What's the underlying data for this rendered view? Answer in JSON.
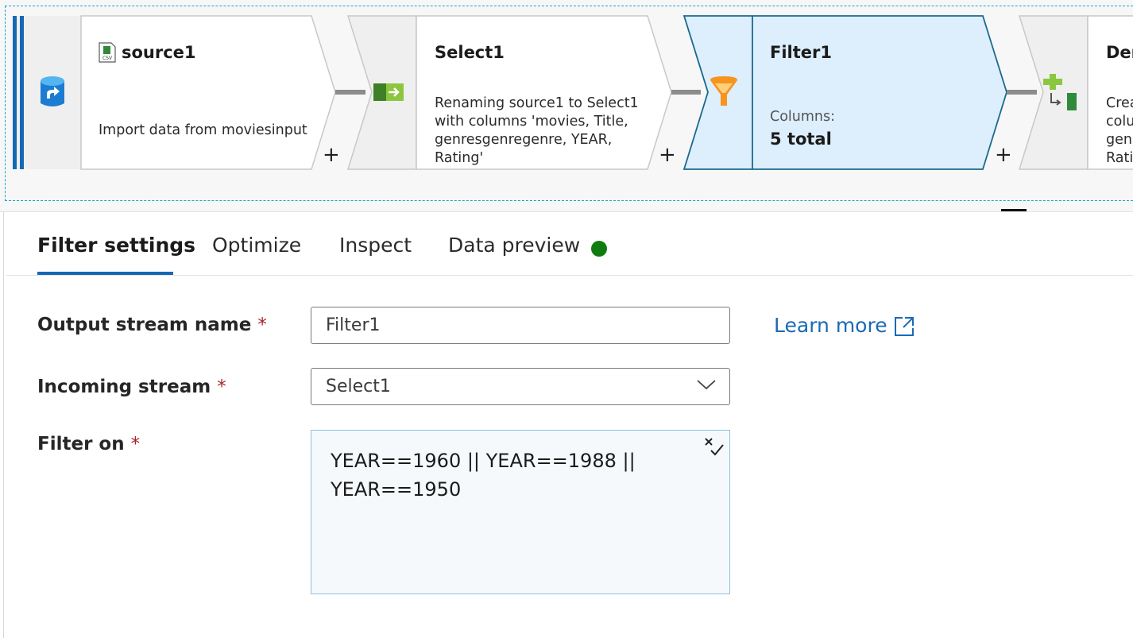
{
  "pipeline": {
    "nodes": [
      {
        "title": "source1",
        "description": "Import data from moviesinput",
        "icon": "database-source-icon",
        "badge_icon": "csv-file-icon"
      },
      {
        "title": "Select1",
        "description_lines": [
          "Renaming source1 to Select1",
          "with columns 'movies, Title,",
          "genresgenregenre, YEAR,",
          "Rating'"
        ],
        "icon": "select-transform-icon"
      },
      {
        "title": "Filter1",
        "columns_label": "Columns:",
        "columns_value": "5 total",
        "icon": "funnel-filter-icon",
        "selected": true
      },
      {
        "title": "Der",
        "description_lines": [
          "Crea",
          "colu",
          "gen",
          "Rati"
        ],
        "icon": "derived-column-icon"
      }
    ],
    "add_symbol": "+"
  },
  "tabs": [
    {
      "label": "Filter settings",
      "active": true
    },
    {
      "label": "Optimize"
    },
    {
      "label": "Inspect"
    },
    {
      "label": "Data preview",
      "status_color": "#107c10"
    }
  ],
  "form": {
    "output_stream": {
      "label": "Output stream name",
      "required": "*",
      "value": "Filter1"
    },
    "incoming_stream": {
      "label": "Incoming stream",
      "required": "*",
      "value": "Select1"
    },
    "filter_on": {
      "label": "Filter on",
      "required": "*",
      "expression_lines": [
        "YEAR==1960 || YEAR==1988 ||",
        "YEAR==1950"
      ]
    }
  },
  "learn_more": "Learn more",
  "colors": {
    "accent": "#1468b6",
    "link": "#1a6ab5",
    "selected_node": "#ddeefc",
    "required": "#a4262c"
  }
}
